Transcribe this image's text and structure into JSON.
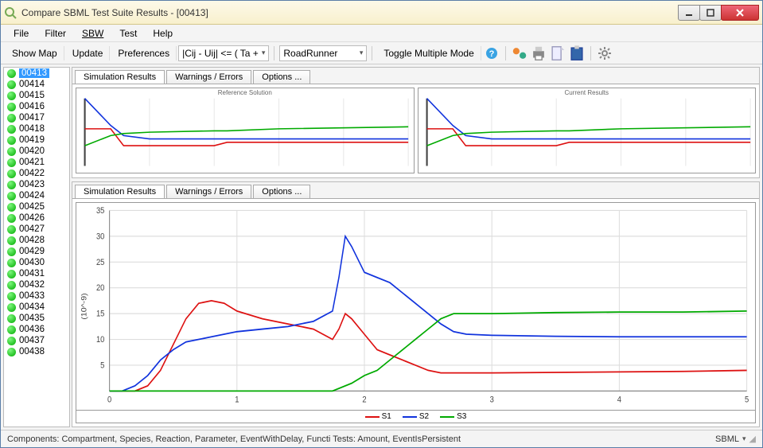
{
  "window": {
    "title": "Compare SBML Test Suite Results    -    [00413]"
  },
  "menu": {
    "items": [
      "File",
      "Filter",
      "SBW",
      "Test",
      "Help"
    ]
  },
  "toolbar": {
    "show_map": "Show Map",
    "update": "Update",
    "preferences": "Preferences",
    "formula_dd": "|Cij - Uij| <= ( Ta +",
    "simulator_dd": "RoadRunner",
    "toggle_multi": "Toggle Multiple Mode"
  },
  "sidebar": {
    "selected": "00413",
    "items": [
      "00413",
      "00414",
      "00415",
      "00416",
      "00417",
      "00418",
      "00419",
      "00420",
      "00421",
      "00422",
      "00423",
      "00424",
      "00425",
      "00426",
      "00427",
      "00428",
      "00429",
      "00430",
      "00431",
      "00432",
      "00433",
      "00434",
      "00435",
      "00436",
      "00437",
      "00438"
    ]
  },
  "tabs_top": {
    "sim": "Simulation Results",
    "warn": "Warnings / Errors",
    "opt": "Options ..."
  },
  "tabs_bottom": {
    "sim": "Simulation Results",
    "warn": "Warnings / Errors",
    "opt": "Options ..."
  },
  "small_left_title": "Reference Solution",
  "small_right_title": "Current Results",
  "statusbar": {
    "left": "Components: Compartment, Species, Reaction, Parameter, EventWithDelay, Functi Tests: Amount, EventIsPersistent",
    "right": "SBML"
  },
  "chart_data": {
    "type": "line",
    "title": "",
    "xlabel": "",
    "ylabel": "(10^-9)",
    "xlim": [
      0,
      5
    ],
    "ylim": [
      0,
      35
    ],
    "xticks": [
      0,
      1,
      2,
      3,
      4,
      5
    ],
    "yticks": [
      5,
      10,
      15,
      20,
      25,
      30,
      35
    ],
    "legend": [
      "S1",
      "S2",
      "S3"
    ],
    "colors": {
      "S1": "#d11",
      "S2": "#13d",
      "S3": "#0a0"
    },
    "x": [
      0,
      0.1,
      0.2,
      0.3,
      0.4,
      0.5,
      0.6,
      0.7,
      0.8,
      0.9,
      1.0,
      1.2,
      1.4,
      1.6,
      1.75,
      1.8,
      1.85,
      1.9,
      2.0,
      2.1,
      2.2,
      2.3,
      2.4,
      2.5,
      2.6,
      2.7,
      2.8,
      3.0,
      3.5,
      4.0,
      4.5,
      5.0
    ],
    "series": [
      {
        "name": "S1",
        "values": [
          0,
          0,
          0,
          1,
          4,
          9,
          14,
          17,
          17.5,
          17,
          15.5,
          14,
          13,
          12,
          10,
          12,
          15,
          14,
          11,
          8,
          7,
          6,
          5,
          4,
          3.5,
          3.5,
          3.5,
          3.5,
          3.6,
          3.7,
          3.8,
          4.0
        ]
      },
      {
        "name": "S2",
        "values": [
          0,
          0,
          1,
          3,
          6,
          8,
          9.5,
          10,
          10.5,
          11,
          11.5,
          12,
          12.5,
          13.5,
          15.5,
          22,
          30,
          28,
          23,
          22,
          21,
          19,
          17,
          15,
          13,
          11.5,
          11,
          10.8,
          10.6,
          10.5,
          10.5,
          10.5
        ]
      },
      {
        "name": "S3",
        "values": [
          0,
          0,
          0,
          0,
          0,
          0,
          0,
          0,
          0,
          0,
          0,
          0,
          0,
          0,
          0,
          0.5,
          1,
          1.5,
          3,
          4,
          6,
          8,
          10,
          12,
          14,
          15,
          15,
          15,
          15.2,
          15.3,
          15.3,
          15.5
        ]
      }
    ]
  },
  "small_chart_data": {
    "type": "line",
    "xlim": [
      0,
      5
    ],
    "ylim": [
      0,
      1
    ],
    "x": [
      0,
      0.4,
      0.6,
      1.0,
      2.0,
      2.2,
      3.0,
      5.0
    ],
    "series": [
      {
        "name": "S1",
        "color": "#d11",
        "values": [
          0.55,
          0.55,
          0.3,
          0.3,
          0.3,
          0.35,
          0.35,
          0.35
        ]
      },
      {
        "name": "S2",
        "color": "#13d",
        "values": [
          1.0,
          0.6,
          0.45,
          0.4,
          0.4,
          0.4,
          0.4,
          0.4
        ]
      },
      {
        "name": "S3",
        "color": "#0a0",
        "values": [
          0.3,
          0.45,
          0.48,
          0.5,
          0.52,
          0.52,
          0.55,
          0.58
        ]
      }
    ]
  }
}
